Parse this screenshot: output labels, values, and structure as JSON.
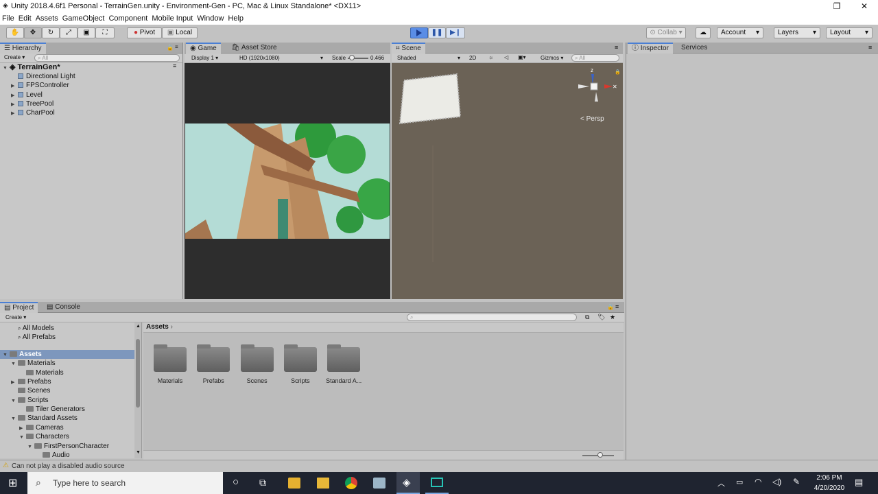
{
  "window": {
    "title": "Unity 2018.4.6f1 Personal - TerrainGen.unity - Environment-Gen - PC, Mac & Linux Standalone* <DX11>"
  },
  "menu": [
    "File",
    "Edit",
    "Assets",
    "GameObject",
    "Component",
    "Mobile Input",
    "Window",
    "Help"
  ],
  "toolbar": {
    "pivot": "Pivot",
    "local": "Local",
    "collab": "Collab",
    "account": "Account",
    "layers": "Layers",
    "layout": "Layout"
  },
  "hierarchy": {
    "tab": "Hierarchy",
    "create": "Create",
    "search_placeholder": "All",
    "scene": "TerrainGen*",
    "items": [
      "Directional Light",
      "FPSController",
      "Level",
      "TreePool",
      "CharPool"
    ]
  },
  "game": {
    "tab": "Game",
    "store_tab": "Asset Store",
    "display": "Display 1",
    "resolution": "HD (1920x1080)",
    "scale_label": "Scale",
    "scale_value": "0.466"
  },
  "scene": {
    "tab": "Scene",
    "shading": "Shaded",
    "mode_2d": "2D",
    "gizmos": "Gizmos",
    "search_placeholder": "All",
    "persp": "< Persp",
    "axis_z": "z"
  },
  "inspector": {
    "tab": "Inspector",
    "services_tab": "Services"
  },
  "project": {
    "tab": "Project",
    "console_tab": "Console",
    "create": "Create",
    "favorites": [
      "All Models",
      "All Prefabs"
    ],
    "tree": [
      {
        "label": "Assets",
        "depth": 0,
        "open": true
      },
      {
        "label": "Materials",
        "depth": 1,
        "open": true
      },
      {
        "label": "Materials",
        "depth": 2
      },
      {
        "label": "Prefabs",
        "depth": 1,
        "closed": true
      },
      {
        "label": "Scenes",
        "depth": 1
      },
      {
        "label": "Scripts",
        "depth": 1,
        "open": true
      },
      {
        "label": "Tiler Generators",
        "depth": 2
      },
      {
        "label": "Standard Assets",
        "depth": 1,
        "open": true
      },
      {
        "label": "Cameras",
        "depth": 2,
        "closed": true
      },
      {
        "label": "Characters",
        "depth": 2,
        "open": true
      },
      {
        "label": "FirstPersonCharacter",
        "depth": 3,
        "open": true
      },
      {
        "label": "Audio",
        "depth": 4
      }
    ],
    "breadcrumb": "Assets",
    "folders": [
      "Materials",
      "Prefabs",
      "Scenes",
      "Scripts",
      "Standard A..."
    ]
  },
  "status": {
    "message": "Can not play a disabled audio source"
  },
  "taskbar": {
    "search_placeholder": "Type here to search",
    "time": "2:06 PM",
    "date": "4/20/2020"
  },
  "colors": {
    "accent": "#4a7fd4",
    "play": "#5a8de6",
    "sky": "#b4dcd6",
    "scene_ground": "#6b6256"
  }
}
